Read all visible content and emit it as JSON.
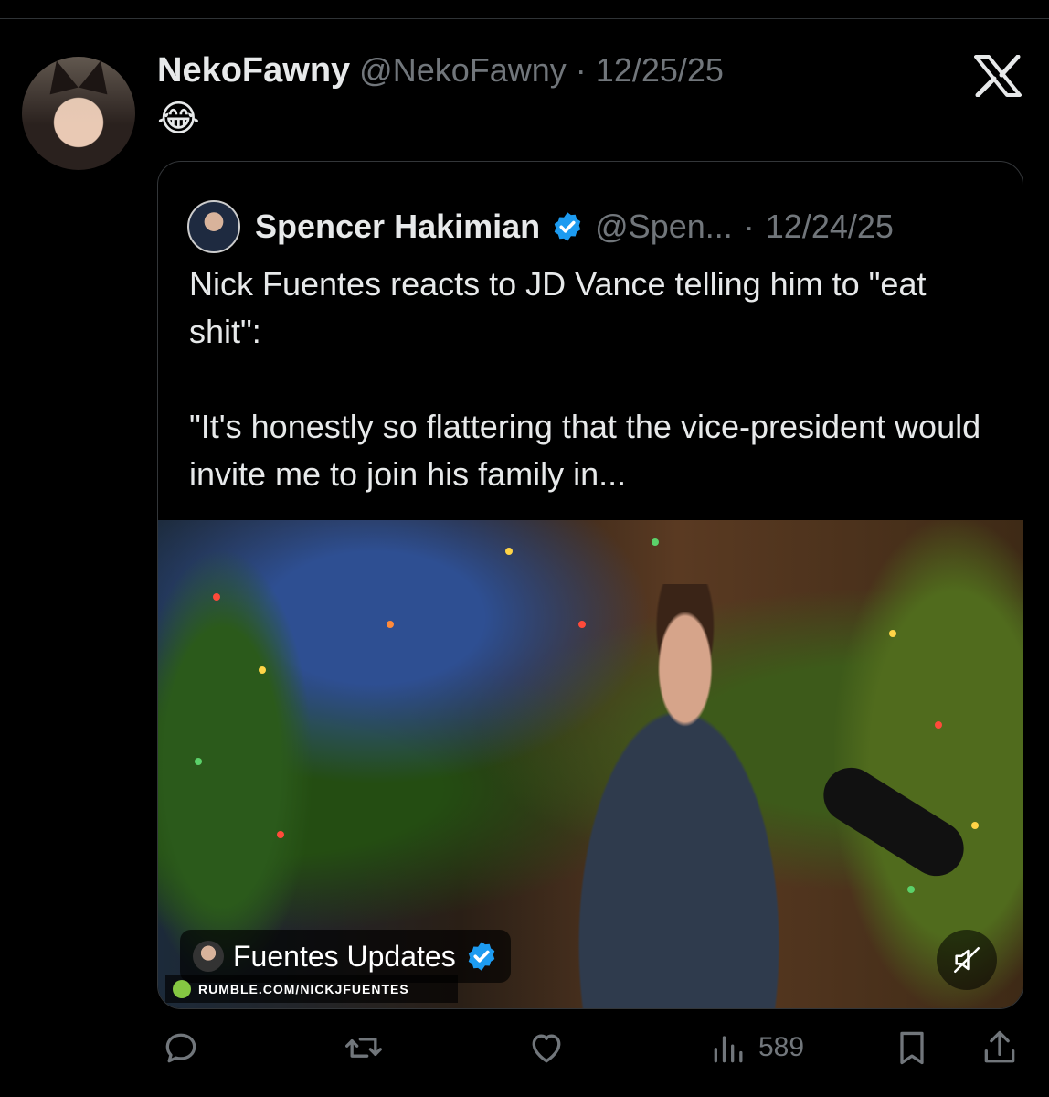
{
  "post": {
    "author_name": "NekoFawny",
    "author_handle": "@NekoFawny",
    "separator": "·",
    "date": "12/25/25",
    "text": "😂"
  },
  "quoted": {
    "author_name": "Spencer Hakimian",
    "author_handle": "@Spen...",
    "separator": "·",
    "date": "12/24/25",
    "text": "Nick Fuentes reacts to JD Vance telling him to \"eat shit\":\n\n\"It's honestly so flattering that the vice-president would invite me to join his family in...",
    "media": {
      "source_name": "Fuentes Updates",
      "watermark": "RUMBLE.COM/NICKJFUENTES"
    }
  },
  "actions": {
    "views_count": "589"
  },
  "icons": {
    "platform": "x-logo-icon",
    "verified": "verified-badge-icon",
    "reply": "reply-icon",
    "repost": "repost-icon",
    "like": "heart-icon",
    "views": "views-icon",
    "bookmark": "bookmark-icon",
    "share": "share-icon",
    "mute": "muted-speaker-icon"
  },
  "colors": {
    "background": "#000000",
    "text": "#e7e9ea",
    "secondary": "#71767b",
    "verified": "#1d9bf0"
  }
}
